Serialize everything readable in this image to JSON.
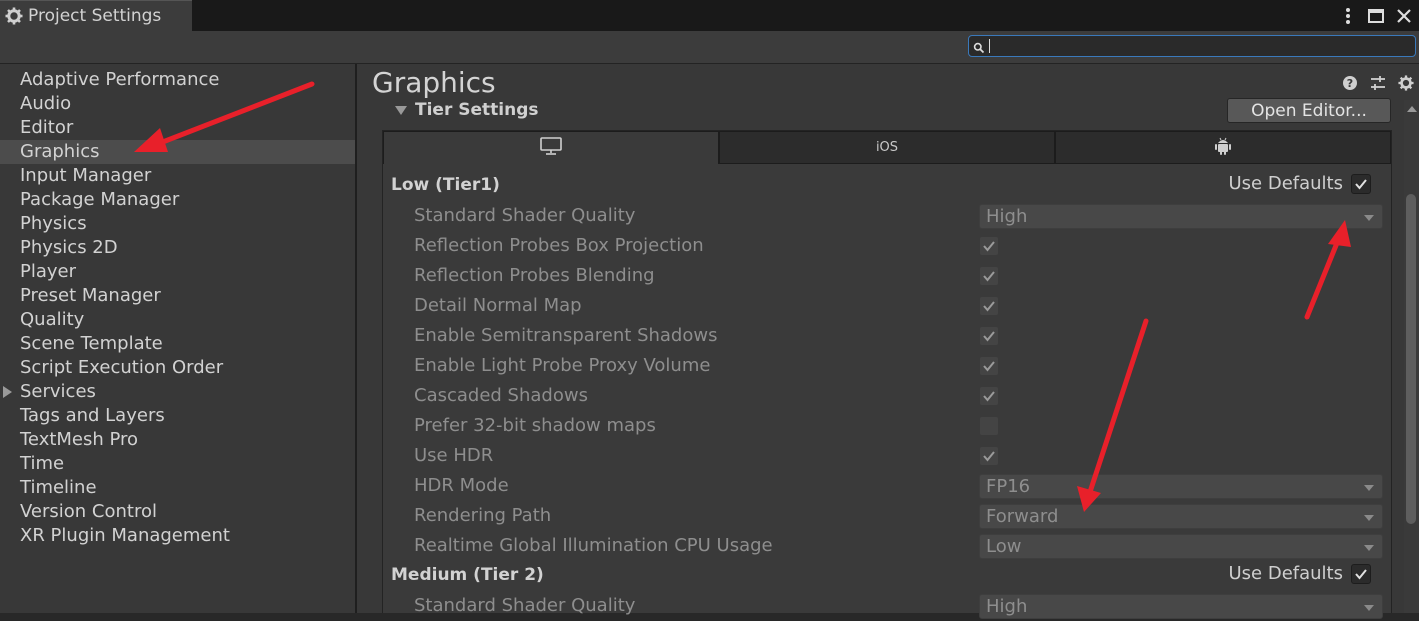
{
  "window": {
    "title": "Project Settings",
    "tab_icon": "gear-icon",
    "controls": [
      "kebab-menu-icon",
      "maximize-icon",
      "close-icon"
    ]
  },
  "search": {
    "value": "",
    "icon": "search-icon"
  },
  "sidebar": {
    "selected": "Graphics",
    "items": [
      {
        "label": "Adaptive Performance"
      },
      {
        "label": "Audio"
      },
      {
        "label": "Editor"
      },
      {
        "label": "Graphics"
      },
      {
        "label": "Input Manager"
      },
      {
        "label": "Package Manager"
      },
      {
        "label": "Physics"
      },
      {
        "label": "Physics 2D"
      },
      {
        "label": "Player"
      },
      {
        "label": "Preset Manager"
      },
      {
        "label": "Quality"
      },
      {
        "label": "Scene Template"
      },
      {
        "label": "Script Execution Order"
      },
      {
        "label": "Services",
        "expandable": true
      },
      {
        "label": "Tags and Layers"
      },
      {
        "label": "TextMesh Pro"
      },
      {
        "label": "Time"
      },
      {
        "label": "Timeline"
      },
      {
        "label": "Version Control"
      },
      {
        "label": "XR Plugin Management"
      }
    ]
  },
  "main": {
    "title": "Graphics",
    "header_icons": [
      "help-icon",
      "presets-icon",
      "settings-gear-icon"
    ],
    "section": {
      "label": "Tier Settings",
      "expanded": true
    },
    "open_editor_label": "Open Editor...",
    "platform_tabs": [
      {
        "icon": "monitor-icon",
        "label": "",
        "selected": true
      },
      {
        "icon": "",
        "label": "iOS",
        "selected": false
      },
      {
        "icon": "android-icon",
        "label": "",
        "selected": false
      }
    ],
    "use_defaults_label": "Use Defaults",
    "tier1": {
      "label": "Low (Tier1)",
      "use_defaults": true,
      "rows": [
        {
          "label": "Standard Shader Quality",
          "type": "dropdown",
          "value": "High"
        },
        {
          "label": "Reflection Probes Box Projection",
          "type": "checkbox",
          "checked": true
        },
        {
          "label": "Reflection Probes Blending",
          "type": "checkbox",
          "checked": true
        },
        {
          "label": "Detail Normal Map",
          "type": "checkbox",
          "checked": true
        },
        {
          "label": "Enable Semitransparent Shadows",
          "type": "checkbox",
          "checked": true
        },
        {
          "label": "Enable Light Probe Proxy Volume",
          "type": "checkbox",
          "checked": true
        },
        {
          "label": "Cascaded Shadows",
          "type": "checkbox",
          "checked": true
        },
        {
          "label": "Prefer 32-bit shadow maps",
          "type": "checkbox",
          "checked": false
        },
        {
          "label": "Use HDR",
          "type": "checkbox",
          "checked": true
        },
        {
          "label": "HDR Mode",
          "type": "dropdown",
          "value": "FP16"
        },
        {
          "label": "Rendering Path",
          "type": "dropdown",
          "value": "Forward"
        },
        {
          "label": "Realtime Global Illumination CPU Usage",
          "type": "dropdown",
          "value": "Low"
        }
      ]
    },
    "tier2": {
      "label": "Medium (Tier 2)",
      "use_defaults": true,
      "rows": [
        {
          "label": "Standard Shader Quality",
          "type": "dropdown",
          "value": "High"
        }
      ]
    }
  },
  "colors": {
    "annotation_arrow": "#e8202a",
    "accent_border": "#3a79bb"
  }
}
